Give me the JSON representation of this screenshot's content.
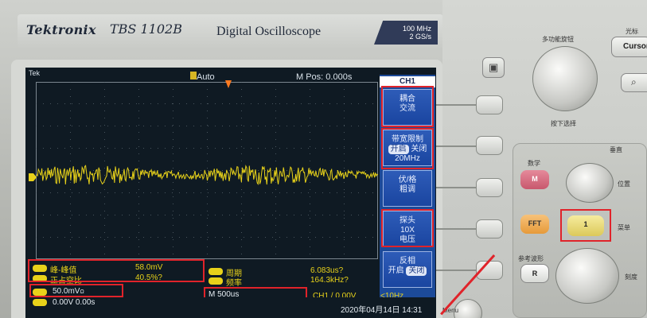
{
  "header": {
    "brand": "Tektronix",
    "model": "TBS 1102B",
    "subtitle": "Digital Oscilloscope",
    "spec_line1": "100 MHz",
    "spec_line2": "2 GS/s"
  },
  "screen": {
    "tek_label": "Tek",
    "trigger_status": "Auto",
    "m_pos": "M Pos: 0.000s"
  },
  "menu": {
    "title": "CH1",
    "items": [
      {
        "line1": "耦合",
        "line2": "交流",
        "line3": ""
      },
      {
        "line1": "带宽限制",
        "line2_sel": "开启",
        "line2_rest": " 关闭",
        "line3": "20MHz"
      },
      {
        "line1": "伏/格",
        "line2": "粗调",
        "line3": ""
      },
      {
        "line1": "探头",
        "line2": "10X",
        "line3": "电压"
      },
      {
        "line1": "反相",
        "line2": "开启",
        "line2_sel": "关闭"
      }
    ]
  },
  "measurements": {
    "peak_label": "峰-峰值",
    "peak_value": "58.0mV",
    "duty_label": "正占空比",
    "duty_value": "40.5%?",
    "period_label": "周期",
    "period_value": "6.083us?",
    "freq_label": "频率",
    "freq_value": "164.3kHz?"
  },
  "status_bar": {
    "ch1_scale": "50.0mV",
    "ch1_scale_sub": "Ω",
    "timebase": "M 500us",
    "trigger": "CH1 / 0.00V",
    "freq_hint": "<10Hz",
    "offset": "0.00V 0.00s",
    "datetime": "2020年04月14日 14:31"
  },
  "panel": {
    "multi_knob_label": "多功能旋钮",
    "push_select": "按下选择",
    "cursor_label": "光标",
    "cursor_button": "Cursor",
    "vertical_section": "垂直",
    "math_label": "数学",
    "math_button": "M",
    "fft_button": "FFT",
    "ch1_button": "1",
    "position_label": "位置",
    "menu_label": "菜单",
    "reference_label": "参考波形",
    "ref_button": "R",
    "scale_label": "刻度",
    "bottom_label": "Menu"
  },
  "colors": {
    "screen_bg": "#0f1a23",
    "trace": "#e8d21a",
    "menu_bg": "#1c4a99",
    "highlight_box": "#e0232a"
  }
}
